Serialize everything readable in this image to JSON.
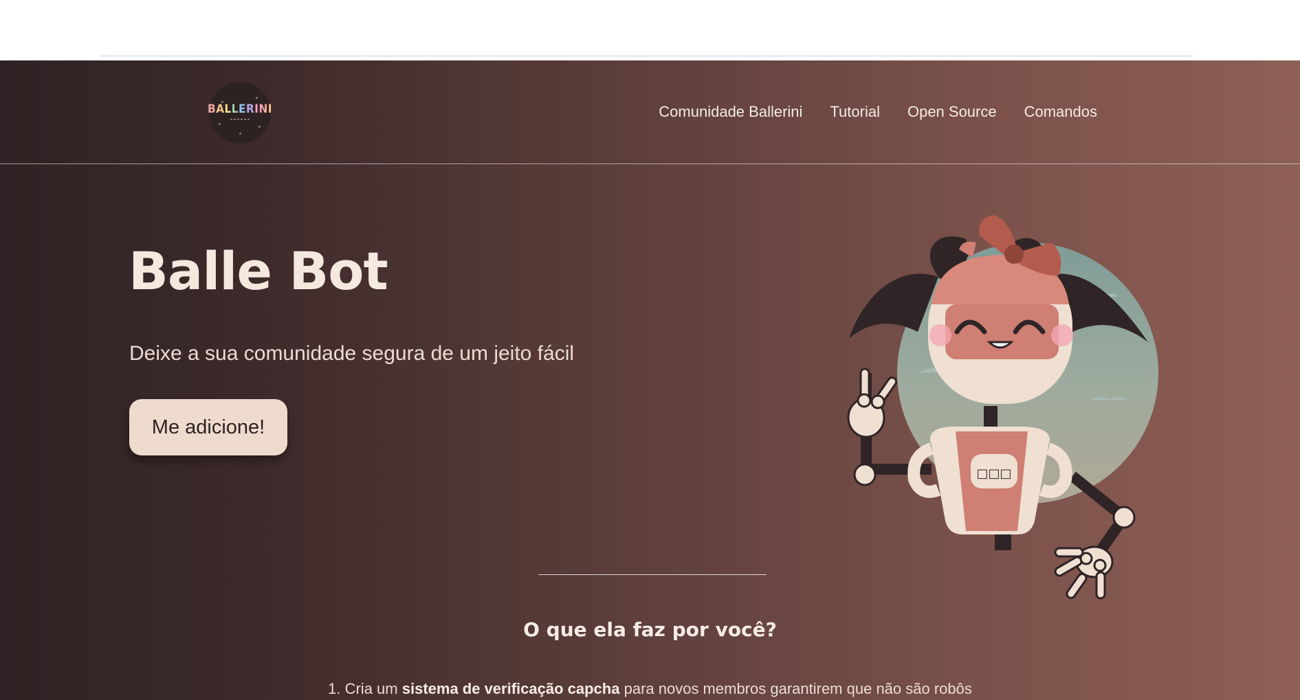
{
  "nav": {
    "logo_letters": [
      "B",
      "A",
      "L",
      "L",
      "E",
      "R",
      "I",
      "N",
      "I"
    ],
    "logo_letter_colors": [
      "#f2a6a6",
      "#f4c28d",
      "#f1e08a",
      "#9fd3b0",
      "#8fc3e6",
      "#b8a7e8",
      "#f0a1c8",
      "#f2a6a6",
      "#f4c28d"
    ],
    "links": [
      "Comunidade Ballerini",
      "Tutorial",
      "Open Source",
      "Comandos"
    ]
  },
  "hero": {
    "title": "Balle Bot",
    "subtitle": "Deixe a sua comunidade segura de um jeito fácil",
    "cta_label": "Me adicione!"
  },
  "mascot": {
    "icon": "robot-girl-mascot",
    "display_text": "□□□"
  },
  "section": {
    "title": "O que ela faz por você?",
    "features": [
      {
        "number": "1.",
        "prefix": "Cria um",
        "bold": "sistema de verificação capcha",
        "suffix": "para novos membros garantirem que não são robôs"
      }
    ]
  },
  "colors": {
    "gradient_start": "#2f2224",
    "gradient_end": "#8e5f55",
    "title": "#f4e8df",
    "button_bg": "#eedbcd",
    "button_text": "#2d2222"
  }
}
